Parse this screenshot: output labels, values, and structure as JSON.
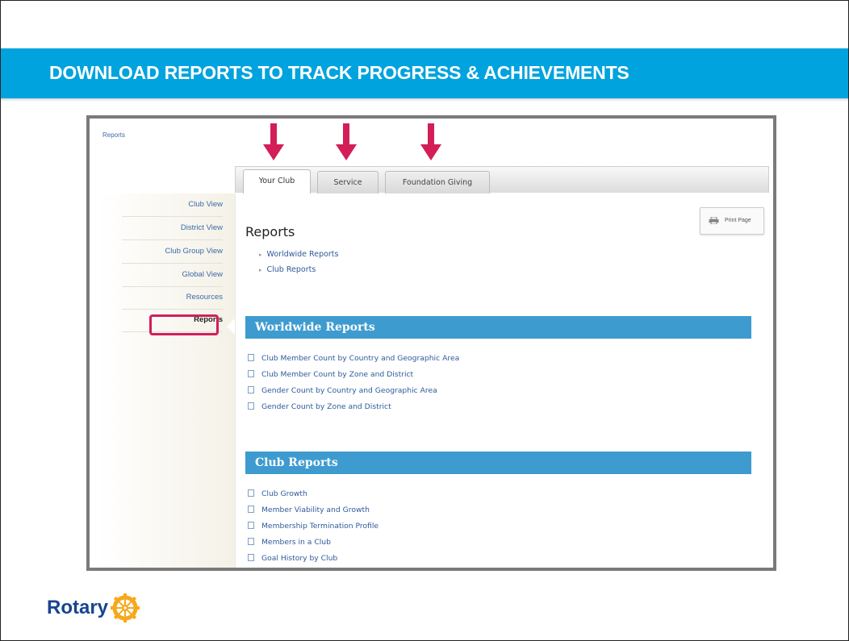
{
  "slide": {
    "title": "DOWNLOAD REPORTS TO TRACK PROGRESS & ACHIEVEMENTS",
    "logo_text": "Rotary"
  },
  "screenshot": {
    "breadcrumb": "Reports",
    "tabs": [
      {
        "label": "Your Club",
        "active": true
      },
      {
        "label": "Service",
        "active": false
      },
      {
        "label": "Foundation Giving",
        "active": false
      }
    ],
    "sidebar": {
      "items": [
        {
          "label": "Club View"
        },
        {
          "label": "District View"
        },
        {
          "label": "Club Group View"
        },
        {
          "label": "Global View"
        },
        {
          "label": "Resources"
        },
        {
          "label": "Reports",
          "active": true
        }
      ]
    },
    "print_label": "Print Page",
    "heading": "Reports",
    "quick_links": [
      "Worldwide Reports",
      "Club Reports"
    ],
    "sections": [
      {
        "title": "Worldwide Reports",
        "links": [
          "Club Member Count by Country and Geographic Area",
          "Club Member Count by Zone and District",
          "Gender Count by Country and Geographic Area",
          "Gender Count by Zone and District"
        ]
      },
      {
        "title": "Club Reports",
        "links": [
          "Club Growth",
          "Member Viability and Growth",
          "Membership Termination Profile",
          "Members in a Club",
          "Goal History by Club"
        ]
      }
    ],
    "colors": {
      "title_bar": "#00a3dd",
      "section_bar": "#3e9bcf",
      "highlight": "#d11e5c",
      "link": "#2f5a9a"
    }
  }
}
